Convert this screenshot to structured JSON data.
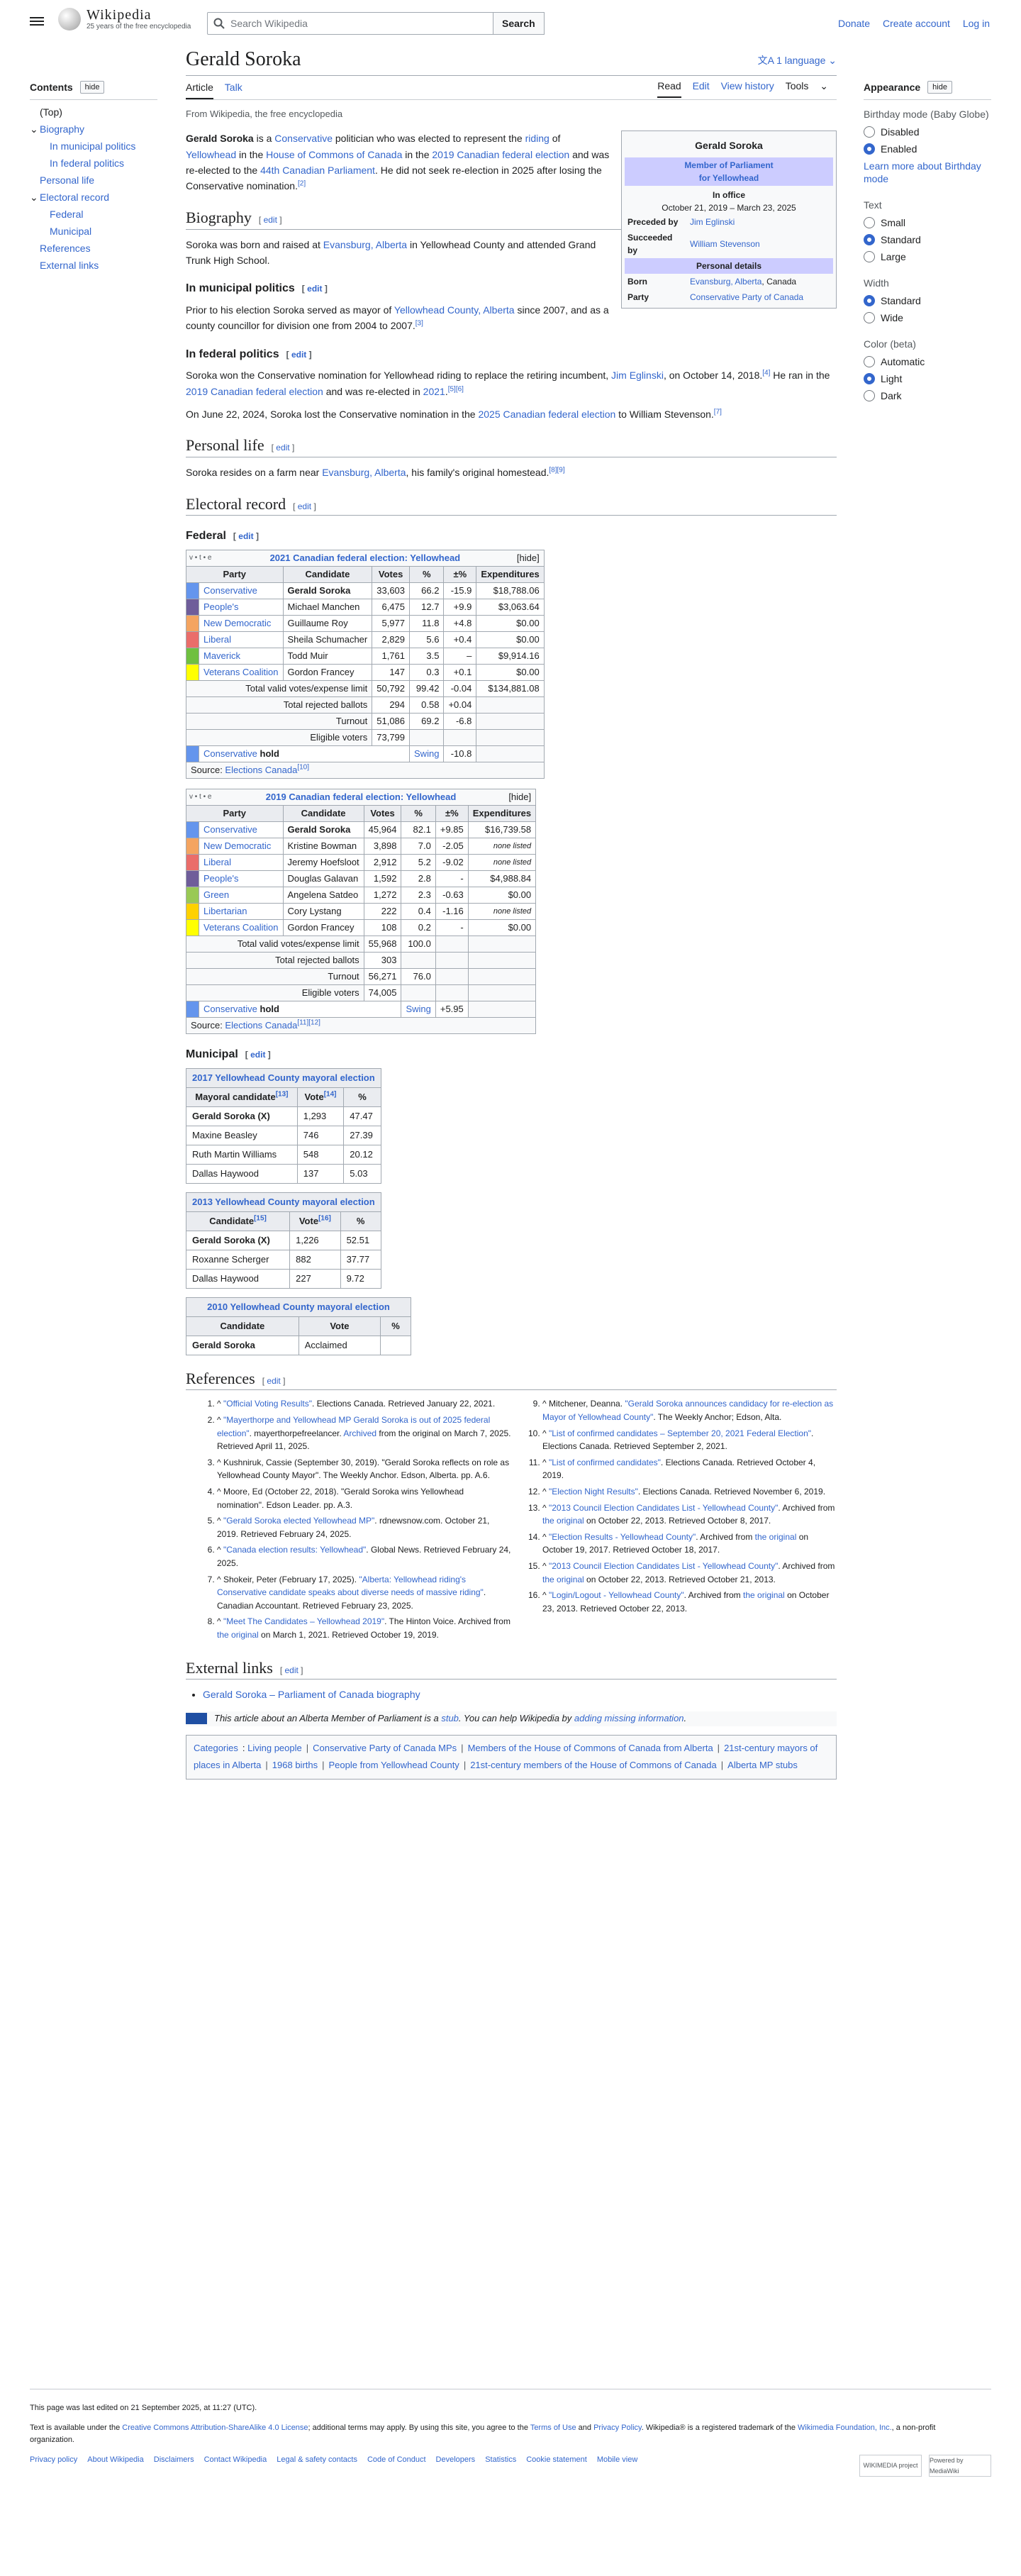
{
  "header": {
    "wordmark": "Wikipedia",
    "tagline": "25 years of the free encyclopedia",
    "search_placeholder": "Search Wikipedia",
    "search_button": "Search",
    "donate": "Donate",
    "create_account": "Create account",
    "log_in": "Log in"
  },
  "toc": {
    "title": "Contents",
    "hide": "hide",
    "items": [
      {
        "label": "(Top)",
        "level": 1
      },
      {
        "label": "Biography",
        "level": 1,
        "caret": "v"
      },
      {
        "label": "In municipal politics",
        "level": 2
      },
      {
        "label": "In federal politics",
        "level": 2
      },
      {
        "label": "Personal life",
        "level": 1
      },
      {
        "label": "Electoral record",
        "level": 1,
        "caret": "v"
      },
      {
        "label": "Federal",
        "level": 2
      },
      {
        "label": "Municipal",
        "level": 2
      },
      {
        "label": "References",
        "level": 1
      },
      {
        "label": "External links",
        "level": 1
      }
    ]
  },
  "appearance": {
    "title": "Appearance",
    "hide": "hide",
    "groups": [
      {
        "title": "Birthday mode (Baby Globe)",
        "options": [
          {
            "label": "Disabled",
            "on": false
          },
          {
            "label": "Enabled",
            "on": true
          }
        ],
        "link": "Learn more about Birthday mode"
      },
      {
        "title": "Text",
        "options": [
          {
            "label": "Small",
            "on": false
          },
          {
            "label": "Standard",
            "on": true
          },
          {
            "label": "Large",
            "on": false
          }
        ]
      },
      {
        "title": "Width",
        "options": [
          {
            "label": "Standard",
            "on": true
          },
          {
            "label": "Wide",
            "on": false
          }
        ]
      },
      {
        "title": "Color (beta)",
        "options": [
          {
            "label": "Automatic",
            "on": false
          },
          {
            "label": "Light",
            "on": true
          },
          {
            "label": "Dark",
            "on": false
          }
        ]
      }
    ]
  },
  "article": {
    "title": "Gerald Soroka",
    "language": "1 language",
    "tabs": {
      "article": "Article",
      "talk": "Talk",
      "read": "Read",
      "edit": "Edit",
      "history": "View history",
      "tools": "Tools"
    },
    "from": "From Wikipedia, the free encyclopedia",
    "lead": [
      {
        "t": "Gerald Soroka",
        "b": true
      },
      {
        "t": " is a "
      },
      {
        "t": "Conservative",
        "a": true
      },
      {
        "t": " politician who was elected to represent the "
      },
      {
        "t": "riding",
        "a": true
      },
      {
        "t": " of "
      },
      {
        "t": "Yellowhead",
        "a": true
      },
      {
        "t": " in the "
      },
      {
        "t": "House of Commons of Canada",
        "a": true
      },
      {
        "t": " in the "
      },
      {
        "t": "2019 Canadian federal election",
        "a": true
      },
      {
        "t": " and was re-elected to the "
      },
      {
        "t": "44th Canadian Parliament",
        "a": true
      },
      {
        "t": ". He did not seek re-election in 2025 after losing the Conservative nomination."
      },
      {
        "t": "[2]",
        "s": true
      }
    ],
    "infobox": {
      "name": "Gerald Soroka",
      "office": "Member of Parliament",
      "office2": "for Yellowhead",
      "in_office": "In office",
      "dates": "October 21, 2019 – March 23, 2025",
      "preceded_label": "Preceded by",
      "preceded": "Jim Eglinski",
      "succeeded_label": "Succeeded by",
      "succeeded": "William Stevenson",
      "personal": "Personal details",
      "born_label": "Born",
      "born_a": "Evansburg, Alberta",
      "born_b": ", Canada",
      "party_label": "Party",
      "party": "Conservative Party of Canada"
    },
    "edit": "edit",
    "biography_h": "Biography",
    "biography": [
      {
        "t": "Soroka was born and raised at "
      },
      {
        "t": "Evansburg, Alberta",
        "a": true
      },
      {
        "t": " in Yellowhead County and attended Grand Trunk High School."
      }
    ],
    "muni_h": "In municipal politics",
    "muni": [
      {
        "t": "Prior to his election Soroka served as mayor of "
      },
      {
        "t": "Yellowhead County, Alberta",
        "a": true
      },
      {
        "t": " since 2007, and as a county councillor for division one from 2004 to 2007."
      },
      {
        "t": "[3]",
        "s": true
      }
    ],
    "fed_h": "In federal politics",
    "fed1": [
      {
        "t": "Soroka won the Conservative nomination for Yellowhead riding to replace the retiring incumbent, "
      },
      {
        "t": "Jim Eglinski",
        "a": true
      },
      {
        "t": ", on October 14, 2018."
      },
      {
        "t": "[4]",
        "s": true
      },
      {
        "t": " He ran in the "
      },
      {
        "t": "2019 Canadian federal election",
        "a": true
      },
      {
        "t": " and was re-elected in "
      },
      {
        "t": "2021",
        "a": true
      },
      {
        "t": "."
      },
      {
        "t": "[5][6]",
        "s": true
      }
    ],
    "fed2": [
      {
        "t": "On June 22, 2024, Soroka lost the Conservative nomination in the "
      },
      {
        "t": "2025 Canadian federal election",
        "a": true
      },
      {
        "t": " to William Stevenson."
      },
      {
        "t": "[7]",
        "s": true
      }
    ],
    "personal_h": "Personal life",
    "personal": [
      {
        "t": "Soroka resides on a farm near "
      },
      {
        "t": "Evansburg, Alberta",
        "a": true
      },
      {
        "t": ", his family's original homestead."
      },
      {
        "t": "[8][9]",
        "s": true
      }
    ],
    "electoral_h": "Electoral record",
    "federal_h": "Federal",
    "municipal_h": "Municipal",
    "references_h": "References",
    "external_h": "External links",
    "external": "Gerald Soroka – Parliament of Canada biography",
    "stub": [
      {
        "t": "This article about an Alberta Member of Parliament is a "
      },
      {
        "t": "stub",
        "a": true
      },
      {
        "t": ". You can help Wikipedia by "
      },
      {
        "t": "adding missing information",
        "a": true
      },
      {
        "t": "."
      }
    ],
    "categories_label": "Categories",
    "categories": [
      "Living people",
      "Conservative Party of Canada MPs",
      "Members of the House of Commons of Canada from Alberta",
      "21st-century mayors of places in Alberta",
      "1968 births",
      "People from Yellowhead County",
      "21st-century members of the House of Commons of Canada",
      "Alberta MP stubs"
    ]
  },
  "elections": [
    {
      "vte": "v • t • e",
      "title": "2021 Canadian federal election: Yellowhead",
      "hide": "[hide]",
      "headers": [
        "Party",
        "Candidate",
        "Votes",
        "%",
        "±%",
        "Expenditures"
      ],
      "rows": [
        {
          "color": "#6495ED",
          "party": "Conservative",
          "cand": "Gerald Soroka",
          "bold": true,
          "votes": "33,603",
          "pct": "66.2",
          "chg": "-15.9",
          "exp": "$18,788.06"
        },
        {
          "color": "#6F5D9A",
          "party": "People's",
          "cand": "Michael Manchen",
          "votes": "6,475",
          "pct": "12.7",
          "chg": "+9.9",
          "exp": "$3,063.64"
        },
        {
          "color": "#F4A460",
          "party": "New Democratic",
          "cand": "Guillaume Roy",
          "votes": "5,977",
          "pct": "11.8",
          "chg": "+4.8",
          "exp": "$0.00"
        },
        {
          "color": "#EA6D6A",
          "party": "Liberal",
          "cand": "Sheila Schumacher",
          "votes": "2,829",
          "pct": "5.6",
          "chg": "+0.4",
          "exp": "$0.00"
        },
        {
          "color": "#6FC040",
          "party": "Maverick",
          "cand": "Todd Muir",
          "votes": "1,761",
          "pct": "3.5",
          "chg": "–",
          "exp": "$9,914.16"
        },
        {
          "color": "#FFFF00",
          "party": "Veterans Coalition",
          "cand": "Gordon Francey",
          "votes": "147",
          "pct": "0.3",
          "chg": "+0.1",
          "exp": "$0.00"
        }
      ],
      "totals": [
        {
          "label": "Total valid votes/expense limit",
          "votes": "50,792",
          "pct": "99.42",
          "chg": "-0.04",
          "exp": "$134,881.08"
        },
        {
          "label": "Total rejected ballots",
          "votes": "294",
          "pct": "0.58",
          "chg": "+0.04"
        },
        {
          "label": "Turnout",
          "votes": "51,086",
          "pct": "69.2",
          "chg": "-6.8"
        },
        {
          "label": "Eligible voters",
          "votes": "73,799"
        }
      ],
      "hold": {
        "color": "#6495ED",
        "party": "Conservative",
        "word": "hold",
        "swing": "Swing",
        "val": "-10.8"
      },
      "source": "Source: ",
      "source_link": "Elections Canada",
      "source_ref": "[10]"
    },
    {
      "vte": "v • t • e",
      "title": "2019 Canadian federal election: Yellowhead",
      "hide": "[hide]",
      "headers": [
        "Party",
        "Candidate",
        "Votes",
        "%",
        "±%",
        "Expenditures"
      ],
      "rows": [
        {
          "color": "#6495ED",
          "party": "Conservative",
          "cand": "Gerald Soroka",
          "bold": true,
          "votes": "45,964",
          "pct": "82.1",
          "chg": "+9.85",
          "exp": "$16,739.58"
        },
        {
          "color": "#F4A460",
          "party": "New Democratic",
          "cand": "Kristine Bowman",
          "votes": "3,898",
          "pct": "7.0",
          "chg": "-2.05",
          "exp": "none listed",
          "it": true
        },
        {
          "color": "#EA6D6A",
          "party": "Liberal",
          "cand": "Jeremy Hoefsloot",
          "votes": "2,912",
          "pct": "5.2",
          "chg": "-9.02",
          "exp": "none listed",
          "it": true
        },
        {
          "color": "#6F5D9A",
          "party": "People's",
          "cand": "Douglas Galavan",
          "votes": "1,592",
          "pct": "2.8",
          "chg": "-",
          "exp": "$4,988.84"
        },
        {
          "color": "#99C955",
          "party": "Green",
          "cand": "Angelena Satdeo",
          "votes": "1,272",
          "pct": "2.3",
          "chg": "-0.63",
          "exp": "$0.00"
        },
        {
          "color": "#FED100",
          "party": "Libertarian",
          "cand": "Cory Lystang",
          "votes": "222",
          "pct": "0.4",
          "chg": "-1.16",
          "exp": "none listed",
          "it": true
        },
        {
          "color": "#FFFF00",
          "party": "Veterans Coalition",
          "cand": "Gordon Francey",
          "votes": "108",
          "pct": "0.2",
          "chg": "-",
          "exp": "$0.00"
        }
      ],
      "totals": [
        {
          "label": "Total valid votes/expense limit",
          "votes": "55,968",
          "pct": "100.0"
        },
        {
          "label": "Total rejected ballots",
          "votes": "303"
        },
        {
          "label": "Turnout",
          "votes": "56,271",
          "pct": "76.0"
        },
        {
          "label": "Eligible voters",
          "votes": "74,005"
        }
      ],
      "hold": {
        "color": "#6495ED",
        "party": "Conservative",
        "word": "hold",
        "swing": "Swing",
        "val": "+5.95"
      },
      "source": "Source: ",
      "source_link": "Elections Canada",
      "source_ref": "[11][12]"
    }
  ],
  "municipal": [
    {
      "title": "2017 Yellowhead County mayoral election",
      "headers": [
        "Mayoral candidate",
        "Vote",
        "%"
      ],
      "hrefs": [
        "[13]",
        "[14]",
        ""
      ],
      "rows": [
        [
          "Gerald Soroka (X)",
          "1,293",
          "47.47"
        ],
        [
          "Maxine Beasley",
          "746",
          "27.39"
        ],
        [
          "Ruth Martin Williams",
          "548",
          "20.12"
        ],
        [
          "Dallas Haywood",
          "137",
          "5.03"
        ]
      ]
    },
    {
      "title": "2013 Yellowhead County mayoral election",
      "headers": [
        "Candidate",
        "Vote",
        "%"
      ],
      "hrefs": [
        "[15]",
        "[16]",
        ""
      ],
      "rows": [
        [
          "Gerald Soroka (X)",
          "1,226",
          "52.51"
        ],
        [
          "Roxanne Scherger",
          "882",
          "37.77"
        ],
        [
          "Dallas Haywood",
          "227",
          "9.72"
        ]
      ]
    },
    {
      "title": "2010 Yellowhead County mayoral election",
      "headers": [
        "Candidate",
        "Vote",
        "%"
      ],
      "hrefs": [
        "",
        "",
        ""
      ],
      "rows": [
        [
          "Gerald Soroka",
          "Acclaimed",
          ""
        ]
      ]
    }
  ],
  "references": [
    [
      {
        "t": "^ "
      },
      {
        "t": "\"Official Voting Results\"",
        "a": true
      },
      {
        "t": ". Elections Canada. Retrieved January 22, 2021."
      }
    ],
    [
      {
        "t": "^ "
      },
      {
        "t": "\"Mayerthorpe and Yellowhead MP Gerald Soroka is out of 2025 federal election\"",
        "a": true
      },
      {
        "t": ". mayerthorpefreelancer. "
      },
      {
        "t": "Archived",
        "a": true
      },
      {
        "t": " from the original on March 7, 2025. Retrieved April 11, 2025."
      }
    ],
    [
      {
        "t": "^ Kushniruk, Cassie (September 30, 2019). \"Gerald Soroka reflects on role as Yellowhead County Mayor\". The Weekly Anchor. Edson, Alberta. pp. A.6."
      }
    ],
    [
      {
        "t": "^ Moore, Ed (October 22, 2018). \"Gerald Soroka wins Yellowhead nomination\". Edson Leader. pp. A.3."
      }
    ],
    [
      {
        "t": "^ "
      },
      {
        "t": "\"Gerald Soroka elected Yellowhead MP\"",
        "a": true
      },
      {
        "t": ". rdnewsnow.com. October 21, 2019. Retrieved February 24, 2025."
      }
    ],
    [
      {
        "t": "^ "
      },
      {
        "t": "\"Canada election results: Yellowhead\"",
        "a": true
      },
      {
        "t": ". Global News. Retrieved February 24, 2025."
      }
    ],
    [
      {
        "t": "^ Shokeir, Peter (February 17, 2025). "
      },
      {
        "t": "\"Alberta: Yellowhead riding's Conservative candidate speaks about diverse needs of massive riding\"",
        "a": true
      },
      {
        "t": ". Canadian Accountant. Retrieved February 23, 2025."
      }
    ],
    [
      {
        "t": "^ "
      },
      {
        "t": "\"Meet The Candidates – Yellowhead 2019\"",
        "a": true
      },
      {
        "t": ". The Hinton Voice. Archived from "
      },
      {
        "t": "the original",
        "a": true
      },
      {
        "t": " on March 1, 2021. Retrieved October 19, 2019."
      }
    ],
    [
      {
        "t": "^ Mitchener, Deanna. "
      },
      {
        "t": "\"Gerald Soroka announces candidacy for re-election as Mayor of Yellowhead County\"",
        "a": true
      },
      {
        "t": ". The Weekly Anchor; Edson, Alta."
      }
    ],
    [
      {
        "t": "^ "
      },
      {
        "t": "\"List of confirmed candidates – September 20, 2021 Federal Election\"",
        "a": true
      },
      {
        "t": ". Elections Canada. Retrieved September 2, 2021."
      }
    ],
    [
      {
        "t": "^ "
      },
      {
        "t": "\"List of confirmed candidates\"",
        "a": true
      },
      {
        "t": ". Elections Canada. Retrieved October 4, 2019."
      }
    ],
    [
      {
        "t": "^ "
      },
      {
        "t": "\"Election Night Results\"",
        "a": true
      },
      {
        "t": ". Elections Canada. Retrieved November 6, 2019."
      }
    ],
    [
      {
        "t": "^ "
      },
      {
        "t": "\"2013 Council Election Candidates List - Yellowhead County\"",
        "a": true
      },
      {
        "t": ". Archived from "
      },
      {
        "t": "the original",
        "a": true
      },
      {
        "t": " on October 22, 2013. Retrieved October 8, 2017."
      }
    ],
    [
      {
        "t": "^ "
      },
      {
        "t": "\"Election Results - Yellowhead County\"",
        "a": true
      },
      {
        "t": ". Archived from "
      },
      {
        "t": "the original",
        "a": true
      },
      {
        "t": " on October 19, 2017. Retrieved October 18, 2017."
      }
    ],
    [
      {
        "t": "^ "
      },
      {
        "t": "\"2013 Council Election Candidates List - Yellowhead County\"",
        "a": true
      },
      {
        "t": ". Archived from "
      },
      {
        "t": "the original",
        "a": true
      },
      {
        "t": " on October 22, 2013. Retrieved October 21, 2013."
      }
    ],
    [
      {
        "t": "^ "
      },
      {
        "t": "\"Login/Logout - Yellowhead County\"",
        "a": true
      },
      {
        "t": ". Archived from "
      },
      {
        "t": "the original",
        "a": true
      },
      {
        "t": " on October 23, 2013. Retrieved October 22, 2013."
      }
    ]
  ],
  "footer": {
    "edited": "This page was last edited on 21 September 2025, at 11:27 (UTC).",
    "license": [
      {
        "t": "Text is available under the "
      },
      {
        "t": "Creative Commons Attribution-ShareAlike 4.0 License",
        "a": true
      },
      {
        "t": "; additional terms may apply. By using this site, you agree to the "
      },
      {
        "t": "Terms of Use",
        "a": true
      },
      {
        "t": " and "
      },
      {
        "t": "Privacy Policy",
        "a": true
      },
      {
        "t": ". Wikipedia® is a registered trademark of the "
      },
      {
        "t": "Wikimedia Foundation, Inc.",
        "a": true
      },
      {
        "t": ", a non-profit organization."
      }
    ],
    "links": [
      "Privacy policy",
      "About Wikipedia",
      "Disclaimers",
      "Contact Wikipedia",
      "Legal & safety contacts",
      "Code of Conduct",
      "Developers",
      "Statistics",
      "Cookie statement",
      "Mobile view"
    ],
    "badge1": "WIKIMEDIA project",
    "badge2": "Powered by MediaWiki"
  }
}
